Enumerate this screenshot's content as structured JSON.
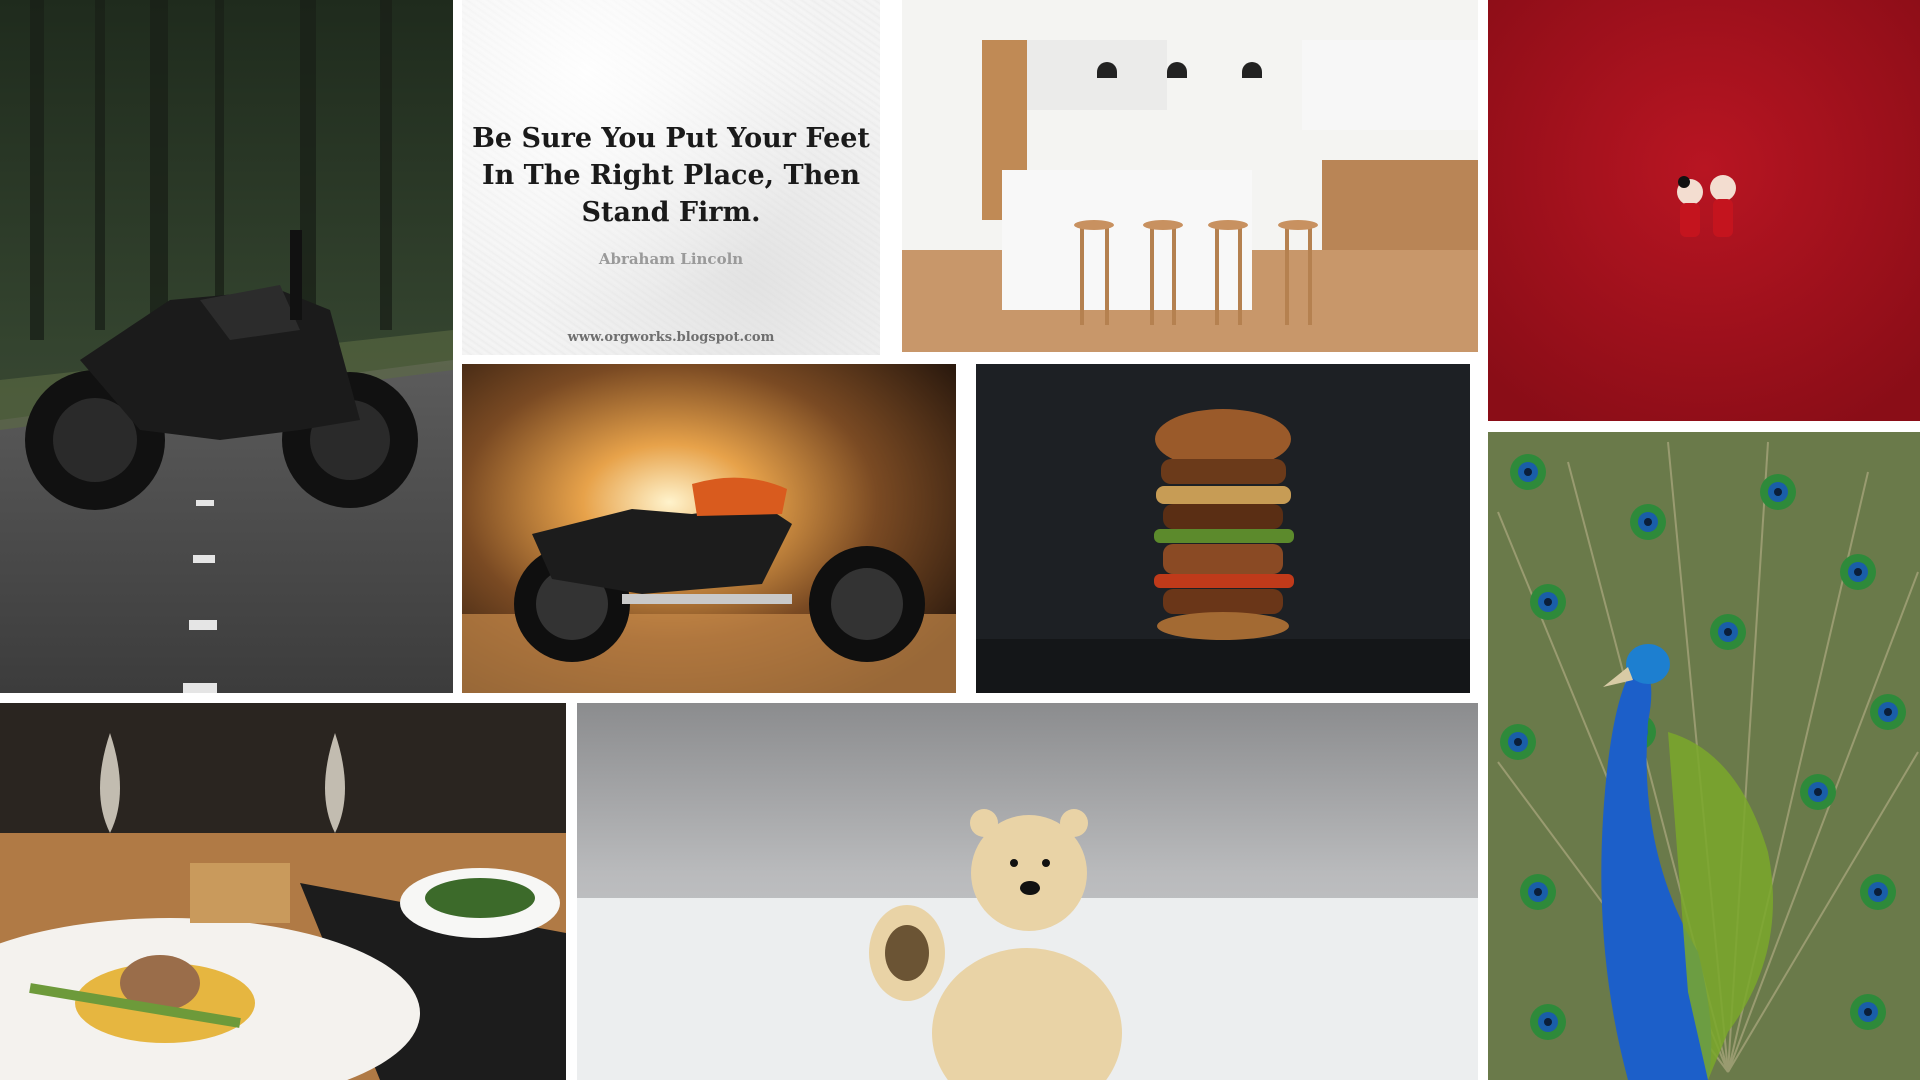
{
  "collage": {
    "tiles": [
      {
        "id": "motorcycle-road",
        "subject": "black motorcycle on forest road"
      },
      {
        "id": "quote-card",
        "subject": "quote card"
      },
      {
        "id": "kitchen",
        "subject": "modern kitchen"
      },
      {
        "id": "red-figurines",
        "subject": "figurines on red background"
      },
      {
        "id": "motorcycle-tunnel",
        "subject": "orange motorcycle in tunnel"
      },
      {
        "id": "burger",
        "subject": "stacked burger"
      },
      {
        "id": "restaurant-plate",
        "subject": "restaurant dinner plate"
      },
      {
        "id": "polar-bear",
        "subject": "polar bear waving"
      },
      {
        "id": "peacock",
        "subject": "peacock"
      }
    ]
  },
  "quote": {
    "text": "Be Sure You Put Your Feet In The Right Place, Then Stand Firm.",
    "author": "Abraham Lincoln",
    "source": "www.orgworks.blogspot.com"
  },
  "colors": {
    "red_bg": "#a4111c",
    "burger_bg": "#1d2024",
    "forest": "#2c3a28"
  }
}
